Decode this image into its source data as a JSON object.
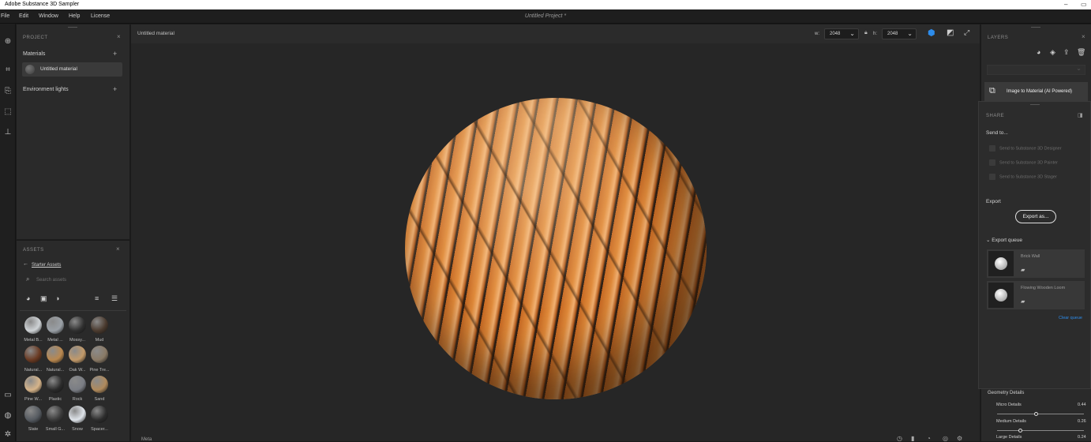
{
  "window": {
    "title": "Adobe Substance 3D Sampler",
    "min_glyph": "–",
    "max_glyph": "▭"
  },
  "menu": {
    "items": [
      "File",
      "Edit",
      "Window",
      "Help",
      "License"
    ],
    "project_title": "Untitled Project *"
  },
  "left_toolbar": {
    "icons": [
      "add-icon",
      "crop-icon",
      "document-icon",
      "frame-icon",
      "stamp-icon",
      "screen-icon",
      "globe-icon",
      "settings-icon"
    ]
  },
  "project_panel": {
    "header": "PROJECT",
    "materials_label": "Materials",
    "material_item": "Untitled material",
    "env_lights_label": "Environment lights"
  },
  "assets_panel": {
    "header": "ASSETS",
    "breadcrumb": "Starter Assets",
    "search_placeholder": "Search assets",
    "thumbs": [
      {
        "label": "Metal B...",
        "color": "#cfd3d6"
      },
      {
        "label": "Metal ...",
        "color": "#9aa0a6"
      },
      {
        "label": "Mossy...",
        "color": "#2f2f2f"
      },
      {
        "label": "Mud",
        "color": "#4a3a2e"
      },
      {
        "label": "Natural...",
        "color": "#6a3a22"
      },
      {
        "label": "Natural...",
        "color": "#b9884f"
      },
      {
        "label": "Oak W...",
        "color": "#c29a6a"
      },
      {
        "label": "Pine Tre...",
        "color": "#8a7a66"
      },
      {
        "label": "Pine W...",
        "color": "#d6b48a"
      },
      {
        "label": "Plastic",
        "color": "#2b2b2b"
      },
      {
        "label": "Rock",
        "color": "#7a7d84"
      },
      {
        "label": "Sand",
        "color": "#b08a5c"
      },
      {
        "label": "Slate",
        "color": "#555a60"
      },
      {
        "label": "Small G...",
        "color": "#3a3a3a"
      },
      {
        "label": "Snow",
        "color": "#dfe4ea"
      },
      {
        "label": "Spacer...",
        "color": "#2d2d2d"
      }
    ]
  },
  "viewport": {
    "material_name": "Untitled material",
    "width_label": "w:",
    "width_value": "2048",
    "height_label": "h:",
    "height_value": "2048",
    "bottom_label": "Meta"
  },
  "layers_panel": {
    "header": "LAYERS",
    "layer_item": "Image to Material (AI Powered)"
  },
  "share_panel": {
    "header": "SHARE",
    "send_to_label": "Send to...",
    "send_targets": [
      "Send to Substance 3D Designer",
      "Send to Substance 3D Painter",
      "Send to Substance 3D Stager"
    ],
    "export_label": "Export",
    "export_button": "Export as...",
    "queue_label": "Export queue",
    "queue_items": [
      {
        "name": "Brick Wall"
      },
      {
        "name": "Flowing Wooden Loom"
      }
    ],
    "clear_queue": "Clear queue"
  },
  "properties": {
    "section": "Geometry Details",
    "params": [
      {
        "label": "Micro Details",
        "value": "0.44"
      },
      {
        "label": "Medium Details",
        "value": "0.26"
      },
      {
        "label": "Large Details",
        "value": "0.24"
      }
    ]
  },
  "colors": {
    "accent": "#2d8ceb",
    "bg": "#1b1b1b",
    "panel": "#2a2a2a"
  }
}
